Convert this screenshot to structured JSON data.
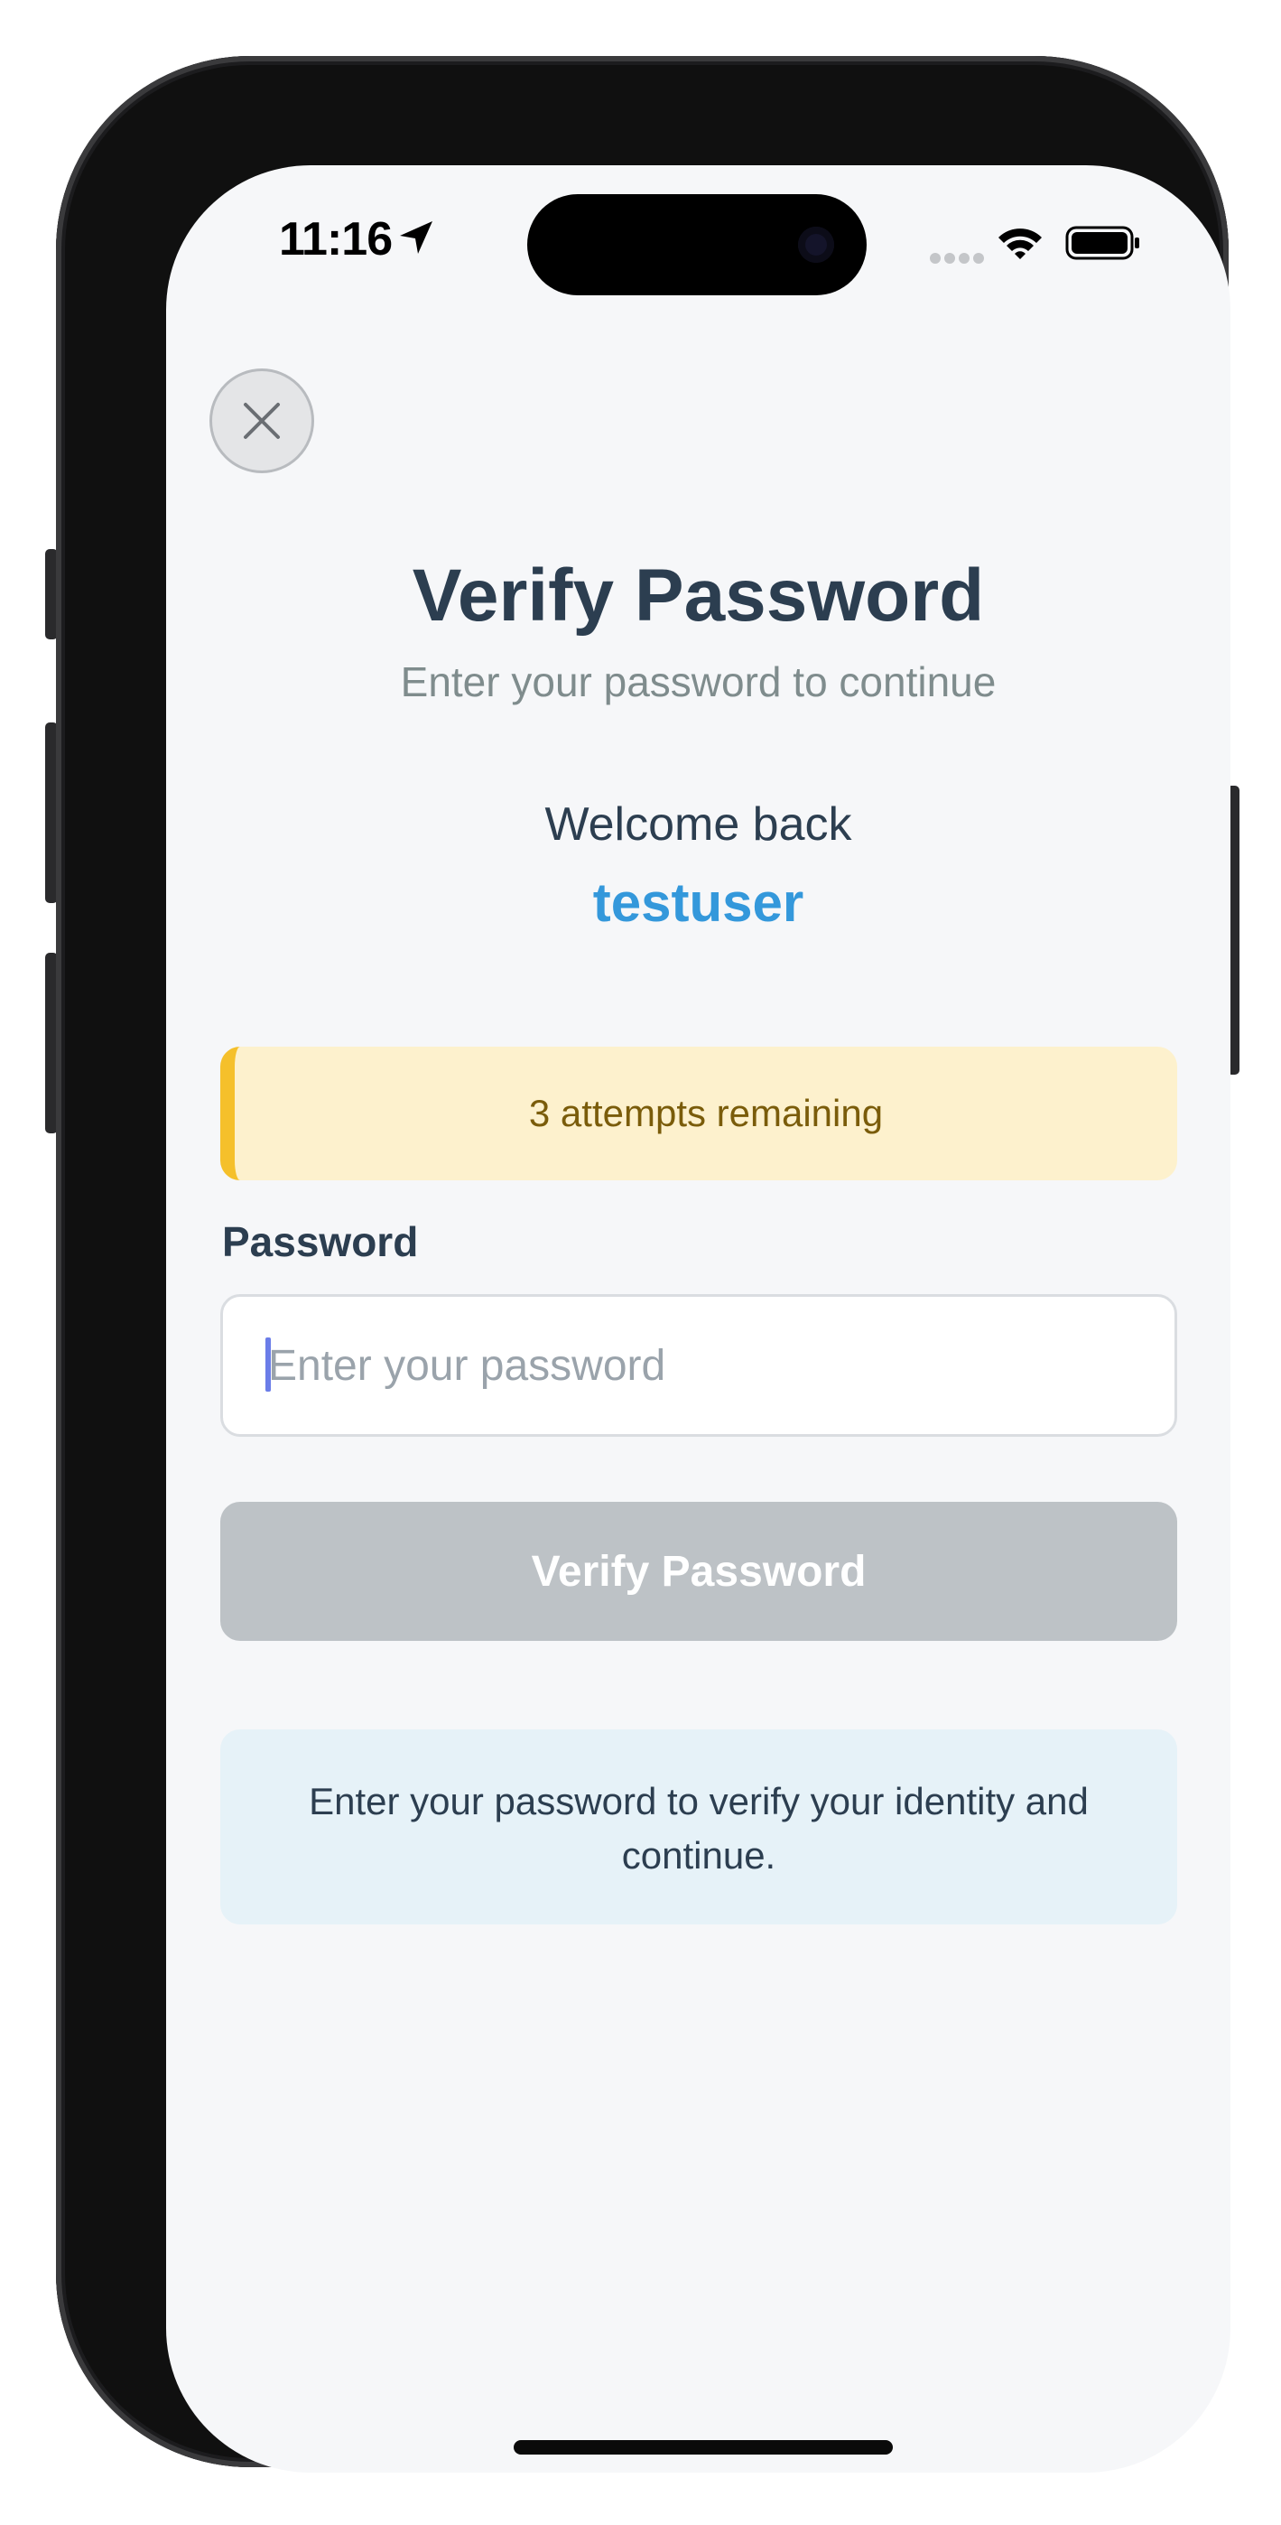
{
  "status_bar": {
    "time": "11:16",
    "location_icon": "location-arrow-icon",
    "signal_icon": "cellular-signal-icon",
    "wifi_icon": "wifi-icon",
    "battery_icon": "battery-icon"
  },
  "close_icon": "close-icon",
  "header": {
    "title": "Verify Password",
    "subtitle": "Enter your password to continue"
  },
  "user": {
    "welcome": "Welcome back",
    "username": "testuser"
  },
  "attempts": {
    "text": "3 attempts remaining"
  },
  "form": {
    "password_label": "Password",
    "password_placeholder": "Enter your password",
    "password_value": "",
    "submit_label": "Verify Password"
  },
  "info": {
    "text": "Enter your password to verify your identity and continue."
  },
  "colors": {
    "title": "#2c3e50",
    "subtitle": "#7f8c8d",
    "username": "#3498db",
    "warning_background": "#fdf1cd",
    "warning_border": "#f5c02b",
    "warning_text": "#7a5c0a",
    "button_disabled": "#bdc2c6",
    "info_background": "#e6f2f8",
    "screen_background": "#f6f7f9"
  }
}
